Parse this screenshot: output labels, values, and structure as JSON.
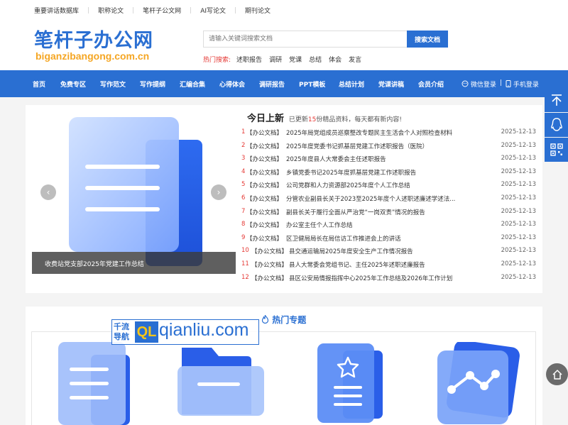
{
  "top_links": [
    "重要讲话数据库",
    "职称论文",
    "笔杆子公文网",
    "AI写论文",
    "期刊论文"
  ],
  "logo": {
    "main": "笔杆子办公网",
    "sub": "biganzibangong.com.cn"
  },
  "search": {
    "placeholder": "请输入关键词搜索文档",
    "button": "搜索文档"
  },
  "hot_search": {
    "label": "热门搜索:",
    "items": [
      "述职报告",
      "调研",
      "党课",
      "总结",
      "体会",
      "发言"
    ]
  },
  "nav": {
    "items": [
      "首页",
      "免费专区",
      "写作范文",
      "写作提纲",
      "汇编合集",
      "心得体会",
      "调研报告",
      "PPT模板",
      "总结计划",
      "党课讲稿",
      "会员介绍"
    ],
    "wechat_login": "微信登录",
    "separator": "|",
    "phone_login": "手机登录"
  },
  "slider": {
    "caption": "收费站党支部2025年党建工作总结",
    "prev": "‹",
    "next": "›"
  },
  "news": {
    "title": "今日上新",
    "subtitle_prefix": "已更新",
    "count": "15",
    "subtitle_suffix": "份精品资料，每天都有新内容!",
    "rows": [
      {
        "num": "1",
        "cat": "【办公文档】",
        "title": "2025年局党组成员巡察整改专题民主生活会个人对照检查材料",
        "date": "2025-12-13"
      },
      {
        "num": "2",
        "cat": "【办公文档】",
        "title": "2025年度党委书记抓基层党建工作述职报告（医院）",
        "date": "2025-12-13"
      },
      {
        "num": "3",
        "cat": "【办公文档】",
        "title": "2025年度县人大常委会主任述职报告",
        "date": "2025-12-13"
      },
      {
        "num": "4",
        "cat": "【办公文档】",
        "title": "乡镇党委书记2025年度抓基层党建工作述职报告",
        "date": "2025-12-13"
      },
      {
        "num": "5",
        "cat": "【办公文档】",
        "title": "公司党群和人力资源部2025年度个人工作总结",
        "date": "2025-12-13"
      },
      {
        "num": "6",
        "cat": "【办公文档】",
        "title": "分管农业副县长关于2023至2025年度个人述职述廉述学述法...",
        "date": "2025-12-13"
      },
      {
        "num": "7",
        "cat": "【办公文档】",
        "title": "副县长关于履行全面从严治党“一岗双责”情况的报告",
        "date": "2025-12-13"
      },
      {
        "num": "8",
        "cat": "【办公文档】",
        "title": "办公室主任个人工作总结",
        "date": "2025-12-13"
      },
      {
        "num": "9",
        "cat": "【办公文档】",
        "title": "区卫健局局长在局信访工作推进会上的讲话",
        "date": "2025-12-13"
      },
      {
        "num": "10",
        "cat": "【办公文档】",
        "title": "县交通运输局2025年度安全生产工作情况报告",
        "date": "2025-12-13"
      },
      {
        "num": "11",
        "cat": "【办公文档】",
        "title": "县人大常委会党组书记、主任2025年述职述廉报告",
        "date": "2025-12-13"
      },
      {
        "num": "12",
        "cat": "【办公文档】",
        "title": "县区公安局情报指挥中心2025年工作总结及2026年工作计划",
        "date": "2025-12-13"
      }
    ]
  },
  "topics": {
    "title": "热门专题"
  },
  "watermark": {
    "cn_line1": "千流",
    "cn_line2": "导航",
    "badge": "QL",
    "url": "qianliu.com"
  },
  "icons": {
    "fire": "fire-icon",
    "wechat": "wechat-icon",
    "phone": "phone-icon",
    "top": "back-to-top-icon",
    "qq": "qq-icon",
    "qr": "qr-code-icon",
    "home": "home-icon"
  },
  "colors": {
    "brand": "#2a6fd2",
    "accent_orange": "#f5a623",
    "highlight_red": "#e53935"
  }
}
